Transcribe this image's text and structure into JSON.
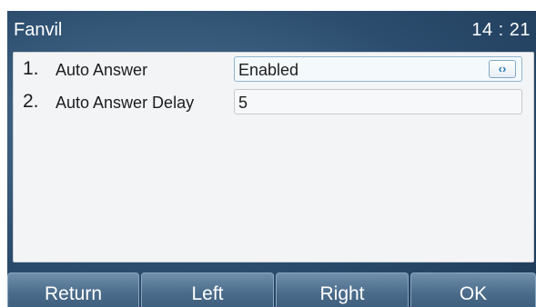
{
  "titlebar": {
    "title": "Fanvil",
    "time": "14 : 21"
  },
  "settings": [
    {
      "number": "1.",
      "label": "Auto Answer",
      "value": "Enabled",
      "switch_icon": "‹›"
    },
    {
      "number": "2.",
      "label": "Auto Answer Delay",
      "value": "5"
    }
  ],
  "softkeys": [
    "Return",
    "Left",
    "Right",
    "OK"
  ]
}
